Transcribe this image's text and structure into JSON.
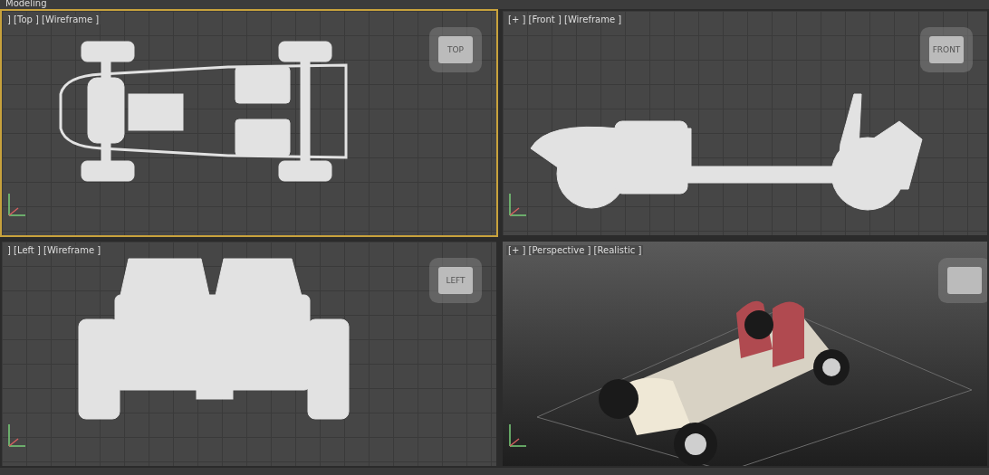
{
  "title_bar": {
    "text": "Modeling"
  },
  "viewports": [
    {
      "label": "] [Top ] [Wireframe ]",
      "kind": "top",
      "selected": true,
      "viewcube": "TOP"
    },
    {
      "label": "[+ ] [Front ] [Wireframe ]",
      "kind": "front",
      "selected": false,
      "viewcube": "FRONT"
    },
    {
      "label": "] [Left ] [Wireframe ]",
      "kind": "left",
      "selected": false,
      "viewcube": "LEFT"
    },
    {
      "label": "[+ ] [Perspective ] [Realistic ]",
      "kind": "perspective",
      "selected": false
    }
  ]
}
